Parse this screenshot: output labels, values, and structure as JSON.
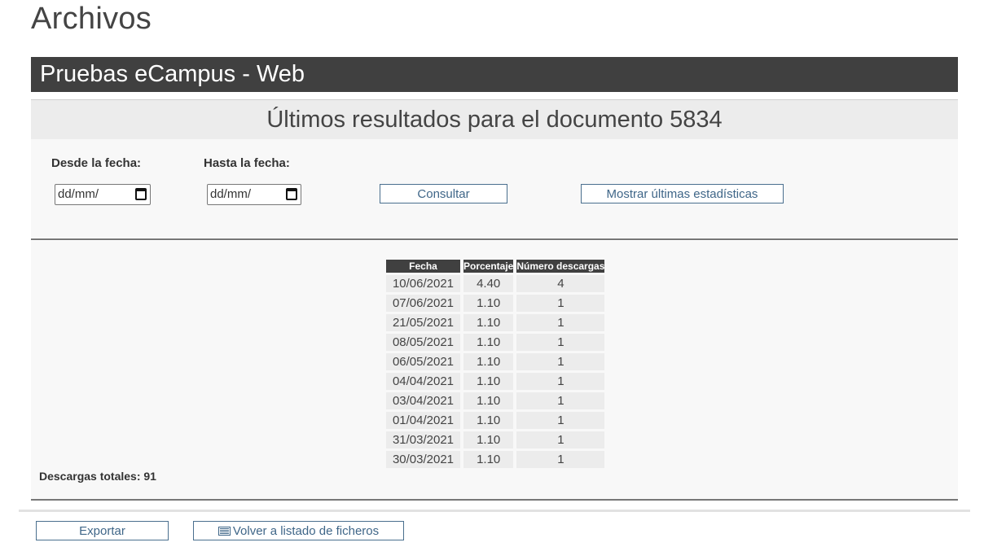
{
  "page": {
    "title": "Archivos"
  },
  "project": {
    "name": "Pruebas eCampus - Web"
  },
  "results_header": {
    "title": "Últimos resultados para el documento 5834"
  },
  "filters": {
    "from_label": "Desde la fecha:",
    "to_label": "Hasta la fecha:",
    "from_placeholder": "dd/mm/",
    "to_placeholder": "dd/mm/",
    "query_button": "Consultar",
    "show_stats_button": "Mostrar últimas estadísticas"
  },
  "table": {
    "headers": [
      "Fecha",
      "Porcentaje",
      "Número descargas"
    ],
    "rows": [
      [
        "10/06/2021",
        "4.40",
        "4"
      ],
      [
        "07/06/2021",
        "1.10",
        "1"
      ],
      [
        "21/05/2021",
        "1.10",
        "1"
      ],
      [
        "08/05/2021",
        "1.10",
        "1"
      ],
      [
        "06/05/2021",
        "1.10",
        "1"
      ],
      [
        "04/04/2021",
        "1.10",
        "1"
      ],
      [
        "03/04/2021",
        "1.10",
        "1"
      ],
      [
        "01/04/2021",
        "1.10",
        "1"
      ],
      [
        "31/03/2021",
        "1.10",
        "1"
      ],
      [
        "30/03/2021",
        "1.10",
        "1"
      ]
    ]
  },
  "totals": {
    "label": "Descargas totales: 91"
  },
  "footer": {
    "export_button": "Exportar",
    "back_button": "Volver a listado de ficheros"
  },
  "icons": {
    "date_picker": "calendar-icon",
    "back": "list-icon"
  },
  "colors": {
    "dark_bar": "#404040",
    "button_border": "#4a6f8e",
    "button_text": "#3f6688"
  }
}
